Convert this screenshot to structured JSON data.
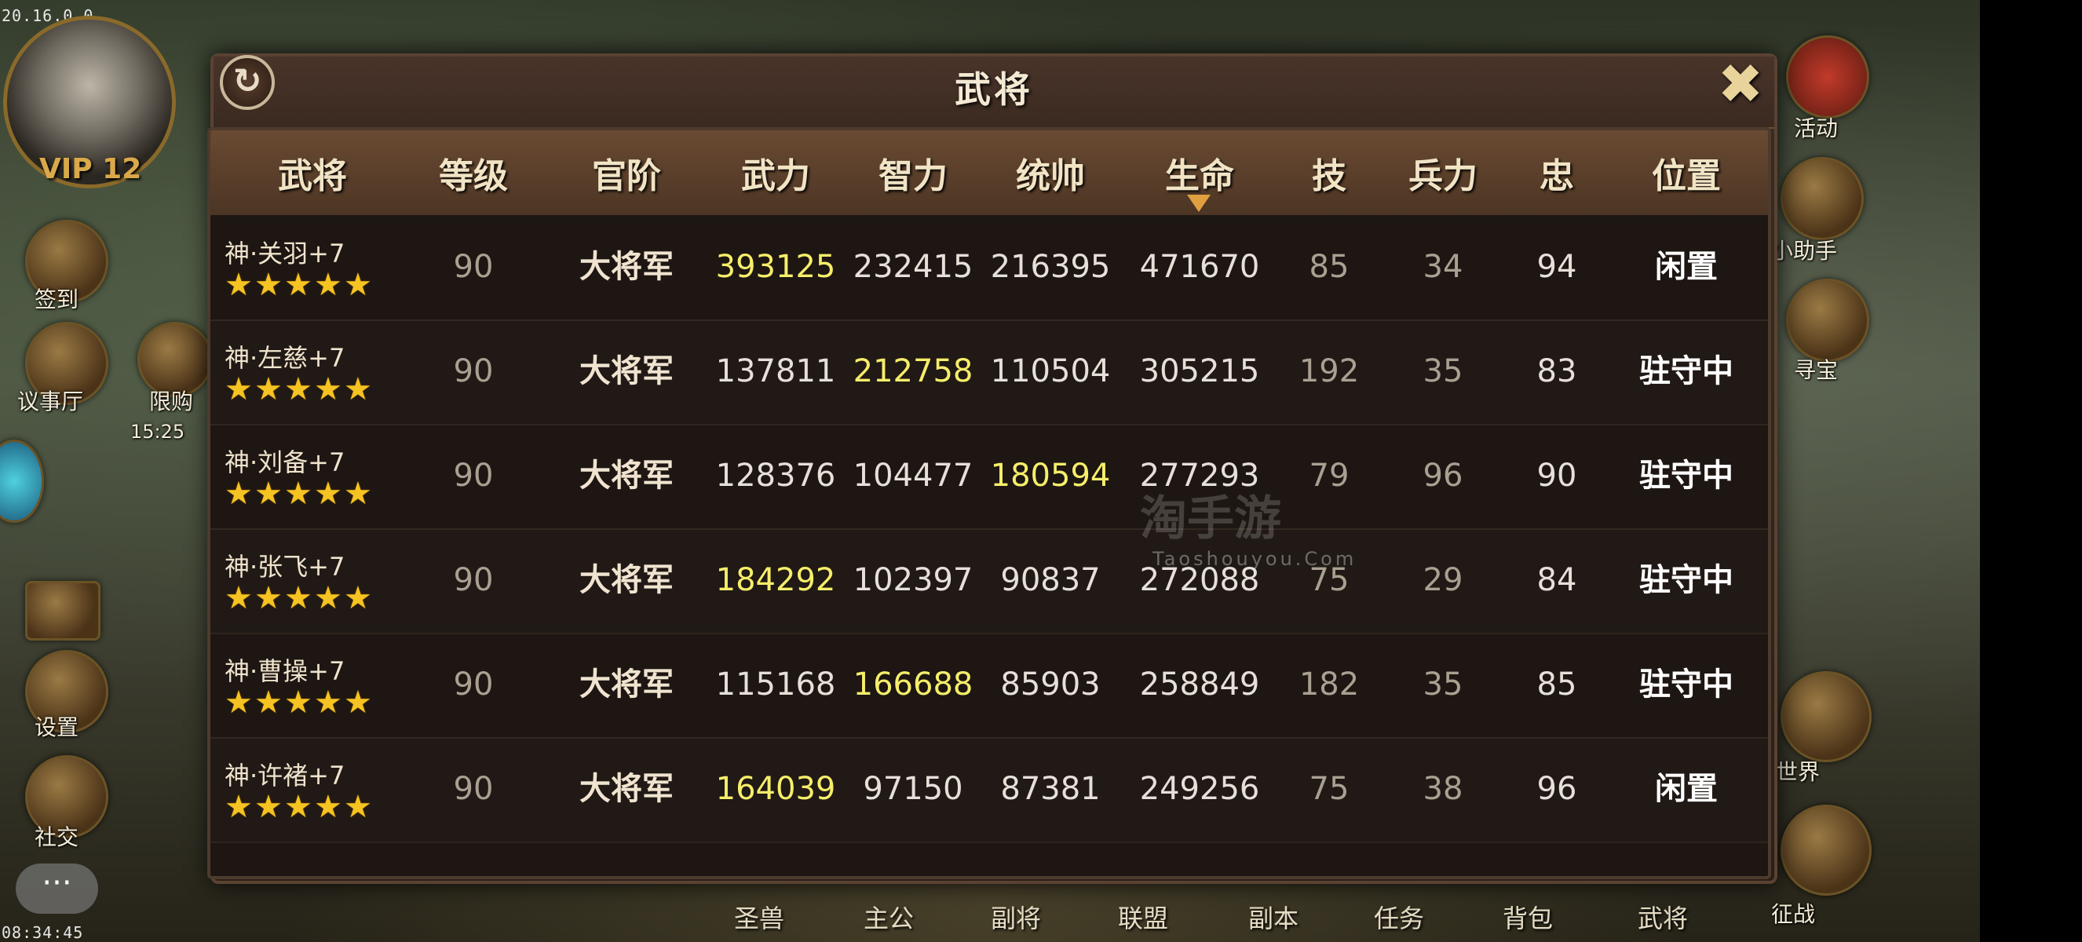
{
  "system": {
    "version": "20.16.0.0",
    "clock": "08:34:45"
  },
  "hud": {
    "vip_label": "VIP 12",
    "left_buttons": [
      "签到",
      "议事厅",
      "设置",
      "社交"
    ],
    "limited_sale": {
      "label": "限购",
      "time": "15:25"
    },
    "right_buttons": [
      "活动",
      "小助手",
      "寻宝",
      "世界",
      "征战"
    ],
    "chat_icon": "chat-bubble-icon"
  },
  "bottom_nav": [
    "圣兽",
    "主公",
    "副将",
    "联盟",
    "副本",
    "任务",
    "背包",
    "武将"
  ],
  "dialog": {
    "title": "武将",
    "refresh_icon": "refresh-icon",
    "close_icon": "close-x-icon",
    "columns": [
      "武将",
      "等级",
      "官阶",
      "武力",
      "智力",
      "统帅",
      "生命",
      "技",
      "兵力",
      "忠",
      "位置"
    ],
    "sorted_column": "生命",
    "rows": [
      {
        "name": "神·关羽+7",
        "stars": 5,
        "level": "90",
        "rank": "大将军",
        "force": "393125",
        "intellect": "232415",
        "command": "216395",
        "hp": "471670",
        "skill": "85",
        "troops": "34",
        "loyalty": "94",
        "position": "闲置",
        "highlight": "force"
      },
      {
        "name": "神·左慈+7",
        "stars": 5,
        "level": "90",
        "rank": "大将军",
        "force": "137811",
        "intellect": "212758",
        "command": "110504",
        "hp": "305215",
        "skill": "192",
        "troops": "35",
        "loyalty": "83",
        "position": "驻守中",
        "highlight": "intellect"
      },
      {
        "name": "神·刘备+7",
        "stars": 5,
        "level": "90",
        "rank": "大将军",
        "force": "128376",
        "intellect": "104477",
        "command": "180594",
        "hp": "277293",
        "skill": "79",
        "troops": "96",
        "loyalty": "90",
        "position": "驻守中",
        "highlight": "command"
      },
      {
        "name": "神·张飞+7",
        "stars": 5,
        "level": "90",
        "rank": "大将军",
        "force": "184292",
        "intellect": "102397",
        "command": "90837",
        "hp": "272088",
        "skill": "75",
        "troops": "29",
        "loyalty": "84",
        "position": "驻守中",
        "highlight": "force"
      },
      {
        "name": "神·曹操+7",
        "stars": 5,
        "level": "90",
        "rank": "大将军",
        "force": "115168",
        "intellect": "166688",
        "command": "85903",
        "hp": "258849",
        "skill": "182",
        "troops": "35",
        "loyalty": "85",
        "position": "驻守中",
        "highlight": "intellect"
      },
      {
        "name": "神·许褚+7",
        "stars": 5,
        "level": "90",
        "rank": "大将军",
        "force": "164039",
        "intellect": "97150",
        "command": "87381",
        "hp": "249256",
        "skill": "75",
        "troops": "38",
        "loyalty": "96",
        "position": "闲置",
        "highlight": "force"
      }
    ]
  },
  "watermark": {
    "text": "淘手游",
    "sub": "Taoshouyou.Com"
  },
  "colors": {
    "highlight": "#f6ee6a",
    "star": "#f5c322",
    "header_bg": "#6a4a32"
  }
}
